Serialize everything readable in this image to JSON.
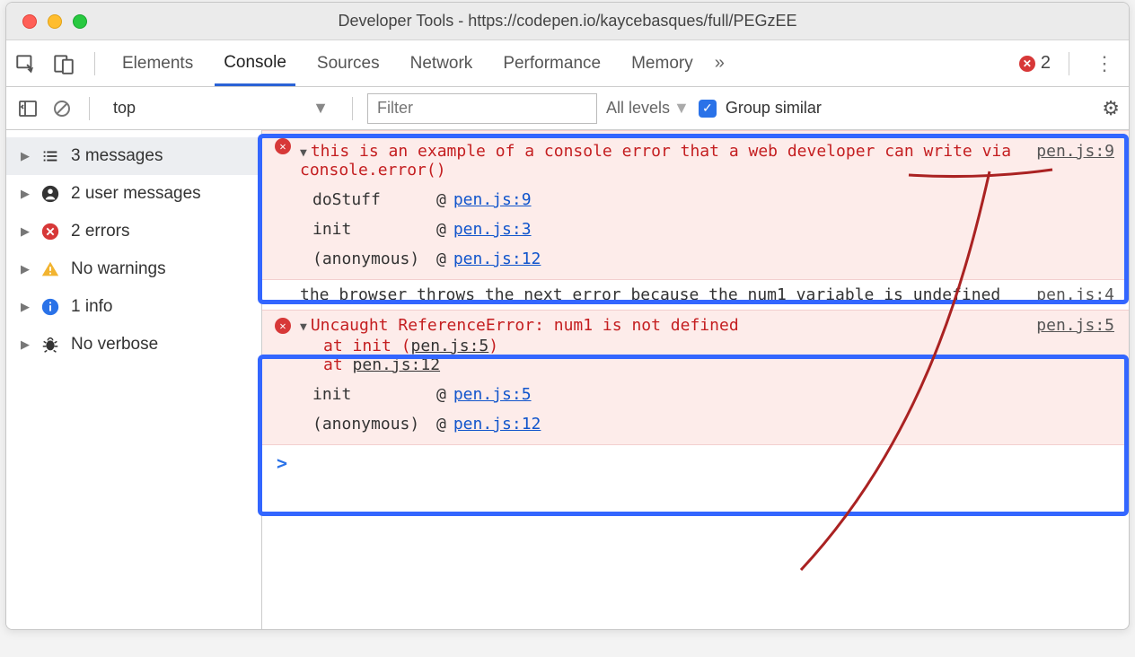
{
  "window": {
    "title": "Developer Tools - https://codepen.io/kaycebasques/full/PEGzEE"
  },
  "tabs": {
    "items": [
      "Elements",
      "Console",
      "Sources",
      "Network",
      "Performance",
      "Memory"
    ],
    "active": "Console",
    "overflow": "»"
  },
  "toperror": {
    "count": "2"
  },
  "filterbar": {
    "context": "top",
    "filter_placeholder": "Filter",
    "levels_label": "All levels",
    "group_similar_label": "Group similar"
  },
  "sidebar": {
    "items": [
      {
        "label": "3 messages"
      },
      {
        "label": "2 user messages"
      },
      {
        "label": "2 errors"
      },
      {
        "label": "No warnings"
      },
      {
        "label": "1 info"
      },
      {
        "label": "No verbose"
      }
    ]
  },
  "console": {
    "error1": {
      "msg": "this is an example of a console error that a web developer can write via console.error()",
      "source": "pen.js:9",
      "stack": [
        {
          "fn": "doStuff",
          "loc": "pen.js:9"
        },
        {
          "fn": "init",
          "loc": "pen.js:3"
        },
        {
          "fn": "(anonymous)",
          "loc": "pen.js:12"
        }
      ]
    },
    "info1": {
      "msg": "the browser throws the next error because the num1 variable is undefined",
      "source": "pen.js:4"
    },
    "error2": {
      "msg": "Uncaught ReferenceError: num1 is not defined",
      "trace_line1_prefix": "at init (",
      "trace_line1_link": "pen.js:5",
      "trace_line1_suffix": ")",
      "trace_line2_prefix": "at ",
      "trace_line2_link": "pen.js:12",
      "source": "pen.js:5",
      "stack": [
        {
          "fn": "init",
          "loc": "pen.js:5"
        },
        {
          "fn": "(anonymous)",
          "loc": "pen.js:12"
        }
      ]
    },
    "prompt": ">"
  }
}
